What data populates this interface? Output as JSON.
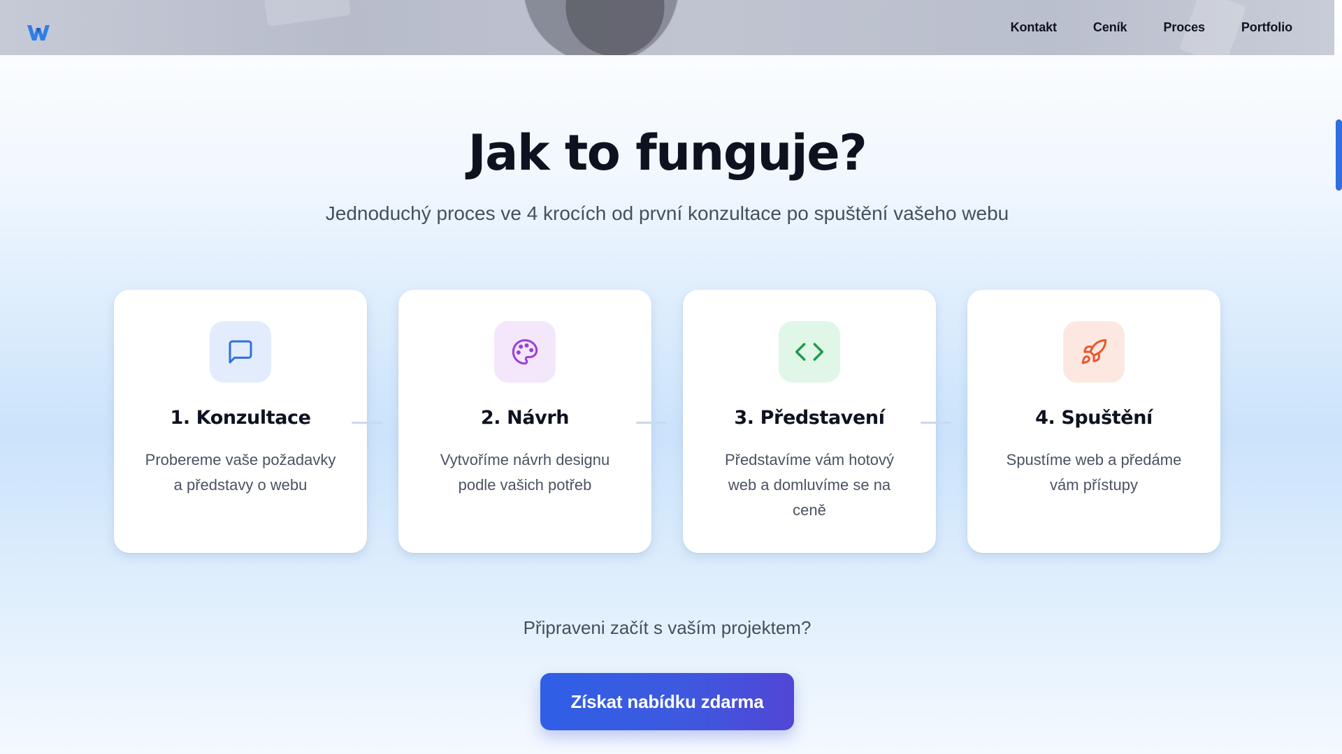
{
  "nav": {
    "items": [
      "Kontakt",
      "Ceník",
      "Proces",
      "Portfolio"
    ]
  },
  "logo": {
    "letter": "W",
    "color": "#2f7fe6"
  },
  "hero": {
    "title": "Jak to funguje?",
    "subtitle": "Jednoduchý proces ve 4 krocích od první konzultace po spuštění vašeho webu"
  },
  "steps": [
    {
      "title": "1. Konzultace",
      "description": "Probereme vaše požadavky a představy o webu",
      "icon": "message-square-icon",
      "icon_color": "#2f6fe0",
      "icon_bg": "#e3ecfd"
    },
    {
      "title": "2. Návrh",
      "description": "Vytvoříme návrh designu podle vašich potřeb",
      "icon": "palette-icon",
      "icon_color": "#9b3fd4",
      "icon_bg": "#f4e6fb"
    },
    {
      "title": "3. Představení",
      "description": "Představíme vám hotový web a domluvíme se na ceně",
      "icon": "code-icon",
      "icon_color": "#1f9a4e",
      "icon_bg": "#e0f7e8"
    },
    {
      "title": "4. Spuštění",
      "description": "Spustíme web a předáme vám přístupy",
      "icon": "rocket-icon",
      "icon_color": "#e8572c",
      "icon_bg": "#fde8e1"
    }
  ],
  "cta": {
    "question": "Připraveni začít s vaším projektem?",
    "button_label": "Získat nabídku zdarma"
  }
}
